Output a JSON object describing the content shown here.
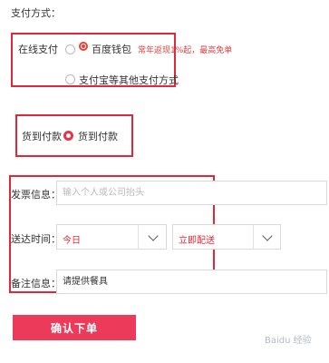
{
  "payment": {
    "section_title": "支付方式：",
    "online_label": "在线支付",
    "baidu_wallet_label": "百度钱包",
    "baidu_promo": "常年返现1%起，最高免单",
    "other_methods_label": "支付宝等其他支付方式",
    "cod_label": "货到付款",
    "cod_option": "货到付款"
  },
  "invoice": {
    "label": "发票信息：",
    "placeholder": "输入个人或公司抬头"
  },
  "delivery": {
    "label": "送达时间：",
    "day_value": "今日",
    "time_value": "立即配送"
  },
  "remark": {
    "label": "备注信息：",
    "value": "请提供餐具"
  },
  "submit_label": "确认下单",
  "watermark": "Baidu 经验",
  "colors": {
    "accent": "#ec3a5a",
    "annotation": "#e0283a"
  }
}
